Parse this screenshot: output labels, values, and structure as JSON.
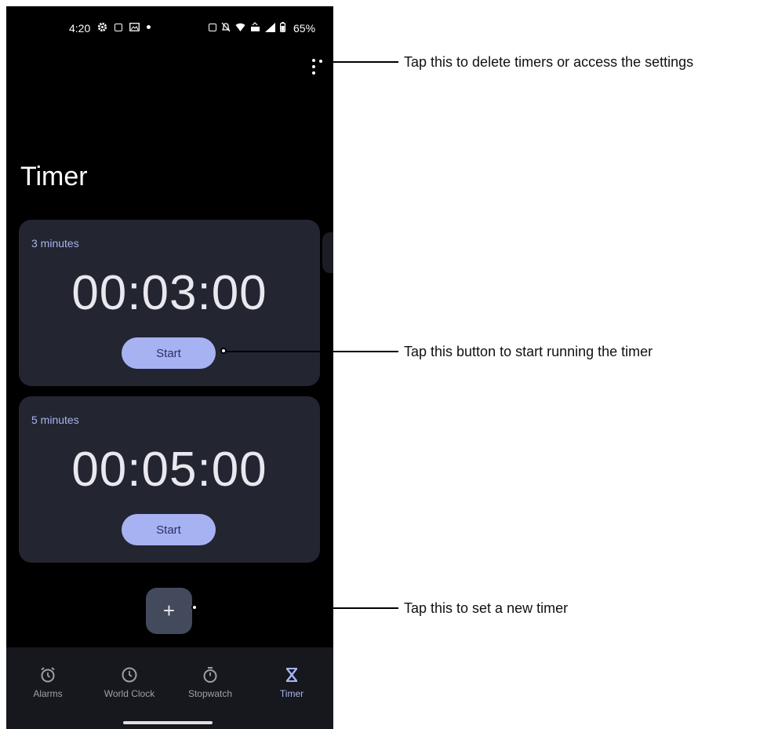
{
  "status_bar": {
    "time": "4:20",
    "battery": "65%"
  },
  "app": {
    "page_title": "Timer",
    "timers": [
      {
        "label": "3 minutes",
        "time": "00:03:00",
        "start_label": "Start"
      },
      {
        "label": "5 minutes",
        "time": "00:05:00",
        "start_label": "Start"
      }
    ],
    "add_button_label": "+",
    "nav": [
      {
        "label": "Alarms",
        "icon": "alarm-icon",
        "active": false
      },
      {
        "label": "World Clock",
        "icon": "clock-icon",
        "active": false
      },
      {
        "label": "Stopwatch",
        "icon": "stopwatch-icon",
        "active": false
      },
      {
        "label": "Timer",
        "icon": "hourglass-icon",
        "active": true
      }
    ]
  },
  "callouts": [
    {
      "text": "Tap this to delete timers or access the settings"
    },
    {
      "text": "Tap this button to start running the timer"
    },
    {
      "text": "Tap this to set a new timer"
    }
  ],
  "colors": {
    "card_bg": "#232530",
    "accent": "#a7b2f2",
    "fab_bg": "#434a5c",
    "nav_bg": "#16181e"
  }
}
